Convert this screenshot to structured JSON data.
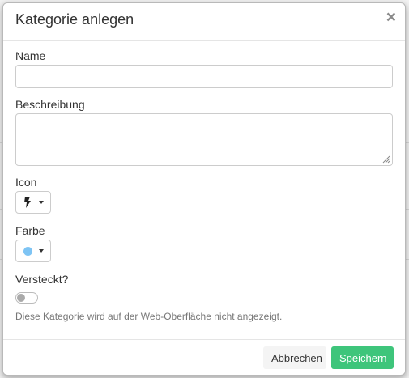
{
  "modal": {
    "title": "Kategorie anlegen",
    "close_symbol": "×"
  },
  "form": {
    "name": {
      "label": "Name",
      "value": "",
      "placeholder": ""
    },
    "description": {
      "label": "Beschreibung",
      "value": "",
      "placeholder": ""
    },
    "icon": {
      "label": "Icon",
      "selected_icon": "bolt-icon"
    },
    "color": {
      "label": "Farbe",
      "selected_color": "#7ec4f4"
    },
    "hidden": {
      "label": "Versteckt?",
      "checked": false,
      "help_text": "Diese Kategorie wird auf der Web-Oberfläche nicht angezeigt."
    }
  },
  "footer": {
    "cancel_label": "Abbrechen",
    "save_label": "Speichern"
  },
  "colors": {
    "save_button": "#3ec57b",
    "cancel_button": "#f4f4f4"
  }
}
